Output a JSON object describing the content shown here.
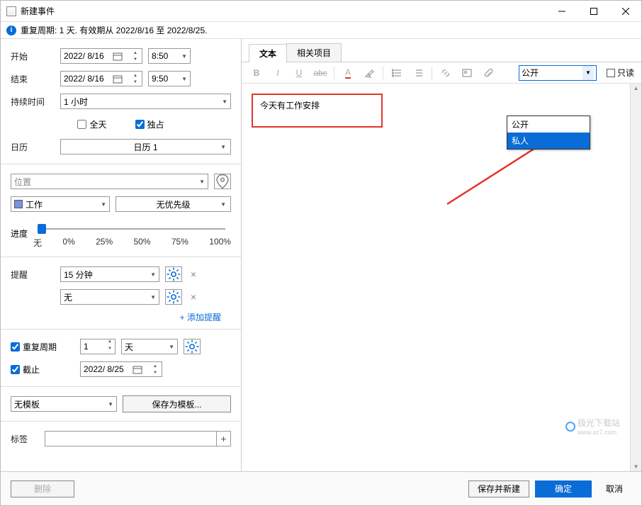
{
  "window": {
    "title": "新建事件"
  },
  "infobar": {
    "text": "重复周期: 1 天. 有效期从 2022/8/16 至 2022/8/25."
  },
  "left": {
    "start_label": "开始",
    "end_label": "结束",
    "start_date": "2022/ 8/16",
    "end_date": "2022/ 8/16",
    "start_time": "8:50",
    "end_time": "9:50",
    "duration_label": "持续时间",
    "duration_value": "1 小时",
    "allday_label": "全天",
    "exclusive_label": "独占",
    "calendar_label": "日历",
    "calendar_value": "日历 1",
    "location_placeholder": "位置",
    "category_value": "工作",
    "priority_value": "无优先级",
    "progress_label": "进度",
    "ticks": [
      "无",
      "0%",
      "25%",
      "50%",
      "75%",
      "100%"
    ],
    "reminder_label": "提醒",
    "reminder1": "15 分钟",
    "reminder2": "无",
    "add_reminder": "+ 添加提醒",
    "repeat_label": "重复周期",
    "repeat_num": "1",
    "repeat_unit": "天",
    "deadline_label": "截止",
    "deadline_date": "2022/ 8/25",
    "template_value": "无模板",
    "save_template": "保存为模板...",
    "tag_label": "标签"
  },
  "right": {
    "tab_text": "文本",
    "tab_related": "相关项目",
    "content": "今天有工作安排",
    "visibility_value": "公开",
    "readonly_label": "只读",
    "visibility_options": [
      "公开",
      "私人"
    ]
  },
  "footer": {
    "delete": "删除",
    "save_new": "保存并新建",
    "ok": "确定",
    "cancel": "取消"
  },
  "watermark": {
    "text": "极光下载站",
    "url": "www.xz7.com"
  }
}
